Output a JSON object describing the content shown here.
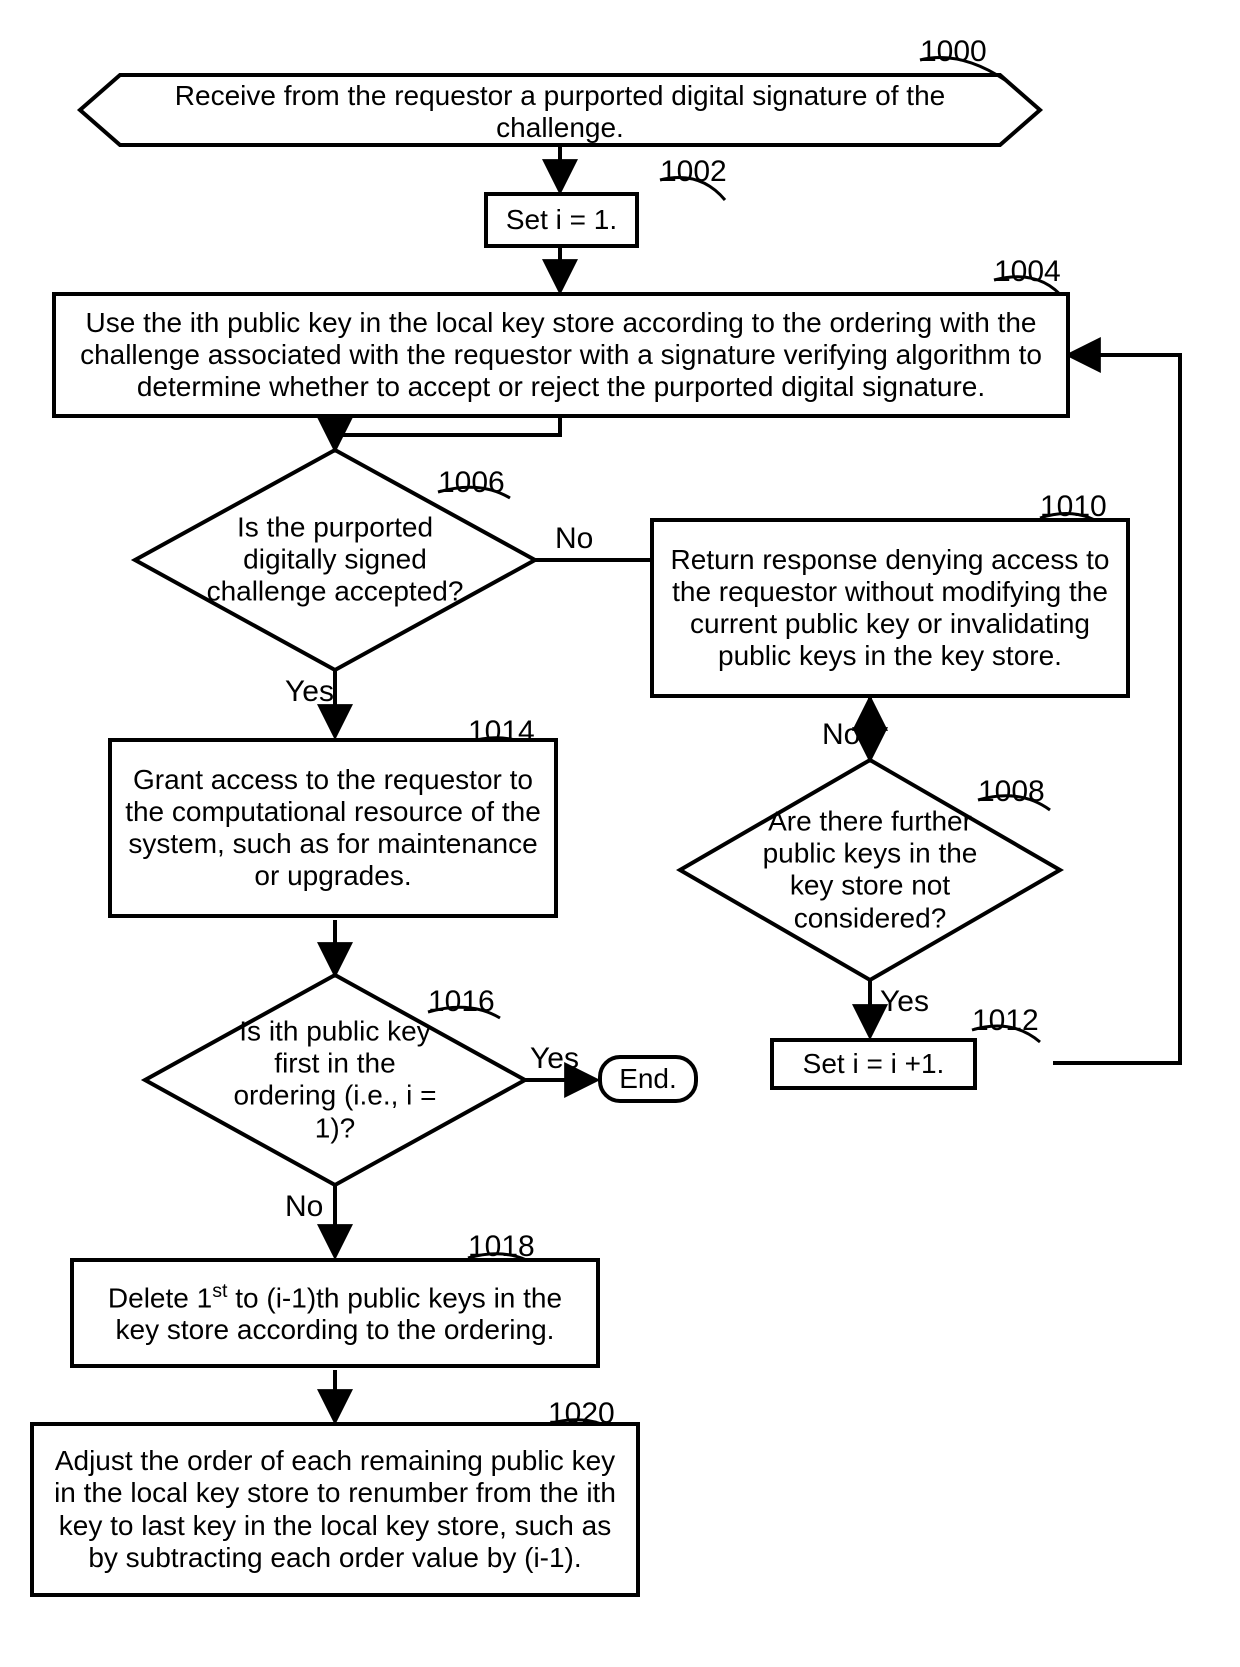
{
  "labels": {
    "n1000": "1000",
    "n1002": "1002",
    "n1004": "1004",
    "n1006": "1006",
    "n1008": "1008",
    "n1010": "1010",
    "n1012": "1012",
    "n1014": "1014",
    "n1016": "1016",
    "n1018": "1018",
    "n1020": "1020"
  },
  "nodes": {
    "n1000": "Receive from the requestor a purported digital signature of the challenge.",
    "n1002": "Set i = 1.",
    "n1004": "Use the ith public key in the local key store according to the ordering with the challenge associated with the requestor with a signature verifying algorithm to determine whether to accept or reject the purported digital signature.",
    "n1006": "Is the purported digitally signed challenge accepted?",
    "n1008": "Are there further public keys in the key store not considered?",
    "n1010": "Return response denying access to the requestor without modifying the current public key or invalidating public keys in the key store.",
    "n1012": "Set i = i +1.",
    "n1014": "Grant access to the requestor to the computational resource of the system, such as for maintenance or upgrades.",
    "n1016": "Is ith public key first in the ordering (i.e., i = 1)?",
    "n1018_a": "Delete 1",
    "n1018_b": "st",
    "n1018_c": " to (i-1)th public keys in the key store according to the ordering.",
    "n1020": "Adjust the order of each remaining public key in the local key store to renumber from the ith key to last key in the local key store, such as by subtracting each order value by (i-1).",
    "end": "End."
  },
  "edges": {
    "yes1": "Yes",
    "no1": "No",
    "yes2": "Yes",
    "no2": "No",
    "yes3": "Yes",
    "no3": "No"
  }
}
